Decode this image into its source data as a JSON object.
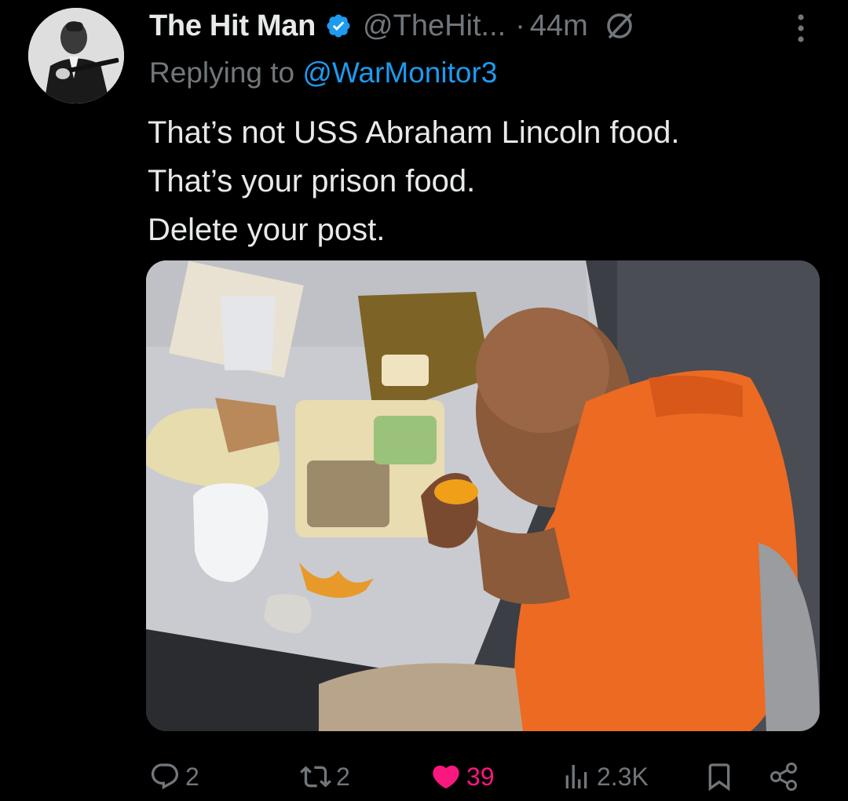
{
  "tweet": {
    "display_name": "The Hit Man",
    "handle": "@TheHit...",
    "separator": "·",
    "time": "44m",
    "reply_prefix": "Replying to",
    "reply_mention": "@WarMonitor3",
    "text_lines": [
      "That’s not USS Abraham Lincoln food.",
      "That’s your prison food.",
      "Delete your post."
    ]
  },
  "actions": {
    "replies": "2",
    "reposts": "2",
    "likes": "39",
    "views": "2.3K"
  },
  "icons": {
    "verified": "verified-badge-icon",
    "grok": "grok-icon",
    "more": "more-vertical-icon",
    "reply": "reply-icon",
    "repost": "repost-icon",
    "like": "heart-filled-icon",
    "views": "views-icon",
    "bookmark": "bookmark-icon",
    "share": "share-icon"
  },
  "colors": {
    "background": "#000000",
    "text": "#e7e9ea",
    "muted": "#71767b",
    "link": "#1d9bf0",
    "like": "#f91880"
  }
}
